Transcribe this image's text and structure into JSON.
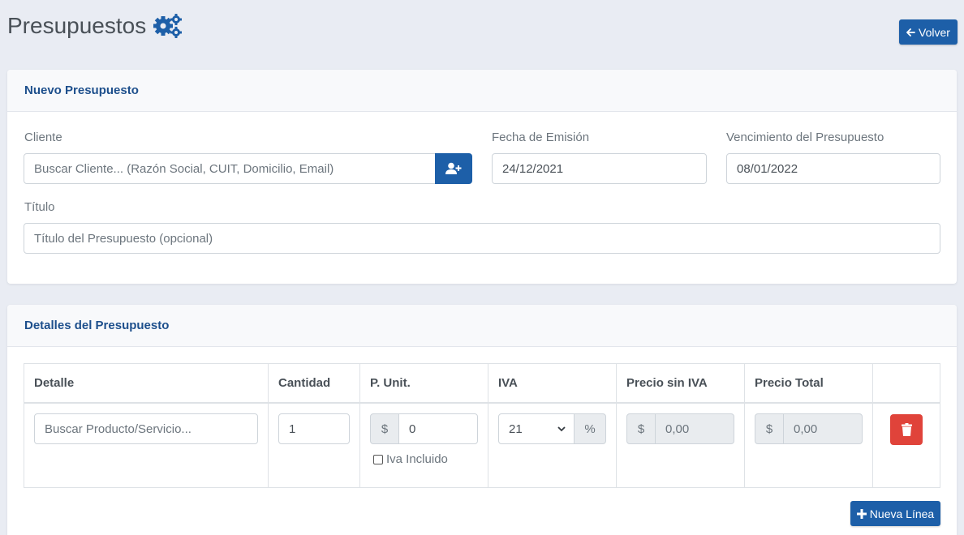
{
  "header": {
    "title": "Presupuestos",
    "back_label": "Volver"
  },
  "nuevo": {
    "heading": "Nuevo Presupuesto",
    "cliente_label": "Cliente",
    "cliente_placeholder": "Buscar Cliente... (Razón Social, CUIT, Domicilio, Email)",
    "fecha_label": "Fecha de Emisión",
    "fecha_value": "24/12/2021",
    "venc_label": "Vencimiento del Presupuesto",
    "venc_value": "08/01/2022",
    "titulo_label": "Título",
    "titulo_placeholder": "Título del Presupuesto (opcional)"
  },
  "detalles": {
    "heading": "Detalles del Presupuesto",
    "columns": [
      "Detalle",
      "Cantidad",
      "P. Unit.",
      "IVA",
      "Precio sin IVA",
      "Precio Total"
    ],
    "row": {
      "producto_placeholder": "Buscar Producto/Servicio...",
      "cantidad": "1",
      "currency": "$",
      "precio_unit": "0",
      "iva_incluido_label": "Iva Incluido",
      "iva_value": "21",
      "percent": "%",
      "precio_sin_iva": "0,00",
      "precio_total": "0,00"
    },
    "new_line_label": "Nueva Línea"
  },
  "colors": {
    "primary": "#1d5fa8",
    "danger": "#e0433a",
    "heading": "#1d4f8c"
  }
}
